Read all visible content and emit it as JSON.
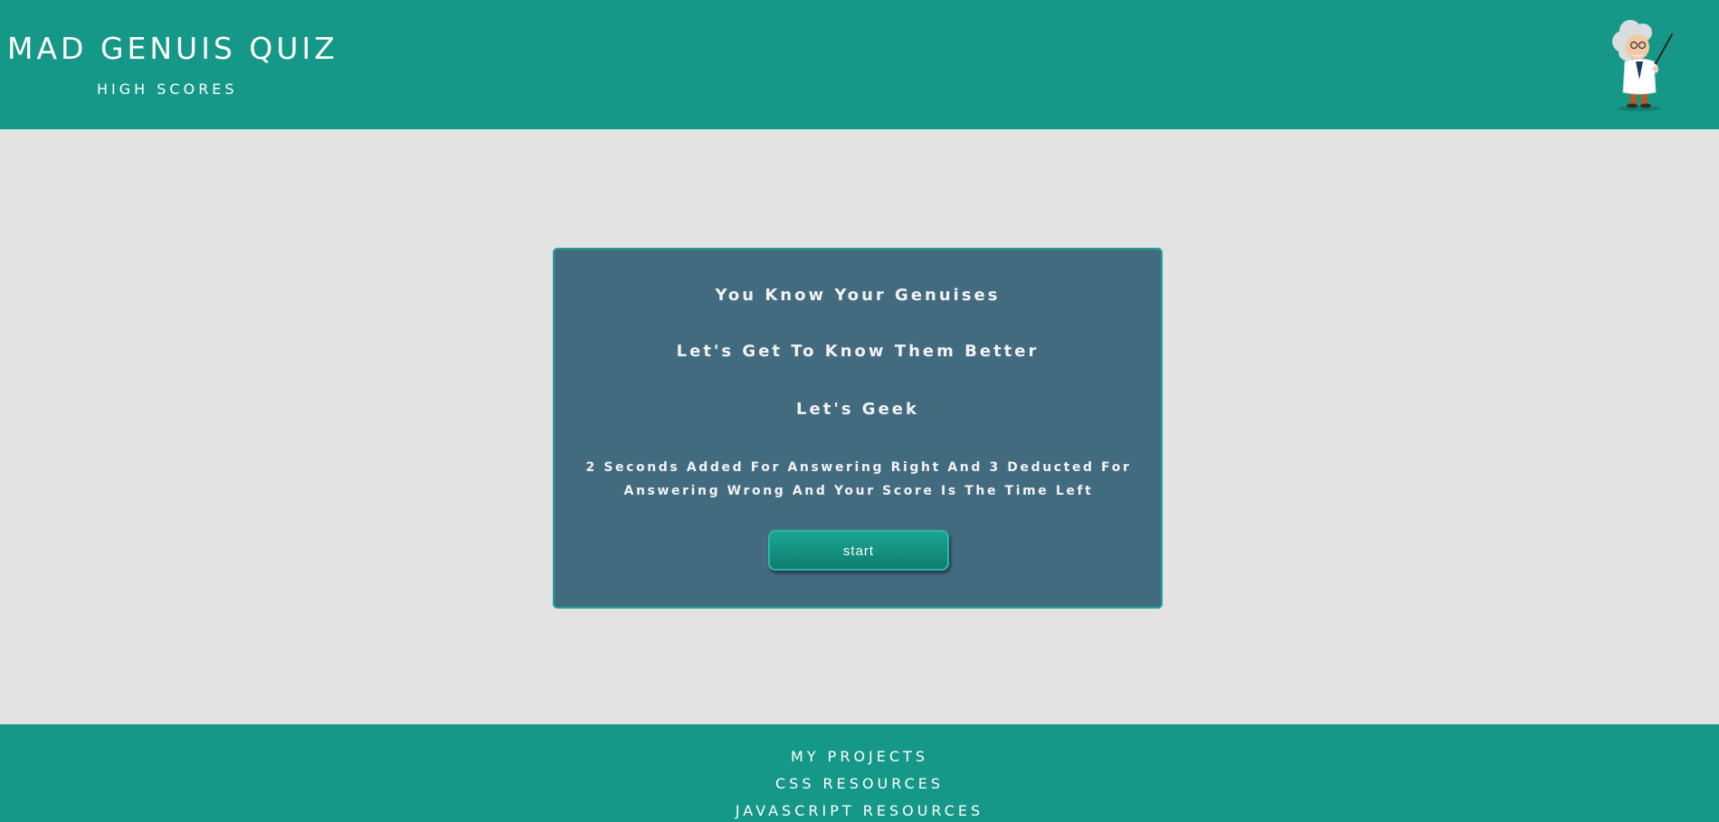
{
  "header": {
    "title": "MAD GENUIS QUIZ",
    "high_scores_link": "HIGH SCORES",
    "mascot_icon": "mad-scientist-icon"
  },
  "intro": {
    "line1": "You Know Your Genuises",
    "line2": "Let's Get To Know Them Better",
    "line3": "Let's Geek",
    "rules": "2 Seconds Added For Answering Right And 3 Deducted For Answering Wrong And Your Score Is The Time Left",
    "start_label": "start"
  },
  "footer": {
    "links": [
      "MY PROJECTS",
      "CSS RESOURCES",
      "JAVASCRIPT RESOURCES"
    ]
  },
  "colors": {
    "header_bg": "#159887",
    "page_bg": "#e3e3e3",
    "card_bg": "#426b80",
    "button_bg": "#129584"
  }
}
